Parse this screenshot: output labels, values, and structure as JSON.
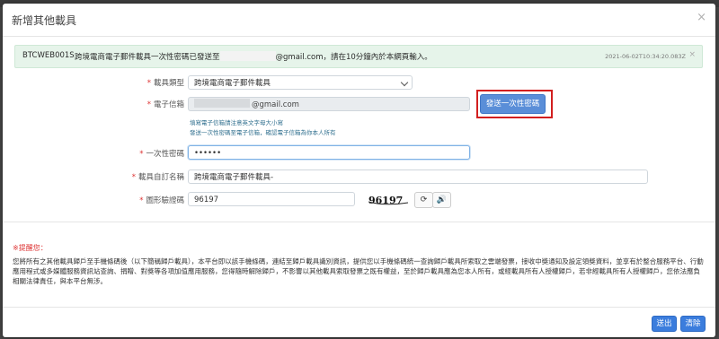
{
  "modal": {
    "title": "新增其他載具",
    "close_icon": "×"
  },
  "alert": {
    "code": "BTCWEB001S",
    "message_prefix": "跨境電商電子郵件載具一次性密碼已發送至",
    "message_suffix": "@gmail.com，請在10分鐘內於本網頁輸入。",
    "timestamp": "2021-06-02T10:34:20.083Z",
    "close_icon": "×"
  },
  "form": {
    "carrier_type": {
      "label": "載具類型",
      "value": "跨境電商電子郵件載具"
    },
    "email": {
      "label": "電子信箱",
      "value": "@gmail.com"
    },
    "send_otp_label": "發送一次性密碼",
    "hints": [
      "填寫電子信箱請注意英文字母大小寫",
      "發送一次性密碼至電子信箱，確認電子信箱為你本人所有"
    ],
    "otp": {
      "label": "一次性密碼",
      "value": "••••••"
    },
    "nickname": {
      "label": "載具自訂名稱",
      "value": "跨境電商電子郵件載具-"
    },
    "captcha": {
      "label": "圖形驗證碼",
      "value": "96197",
      "image_text": "96197",
      "refresh_icon": "⟳",
      "audio_icon": "🔊"
    }
  },
  "notice": {
    "title": "※提醒您：",
    "body": "您將所有之其他載具歸戶至手機條碼後（以下簡稱歸戶載具），本平台即以該手機條碼，連結至歸戶載具識別資訊，提供您以手機條碼統一查詢歸戶載具所索取之雲端發票，接收中獎通知及設定領獎資料，並享有於整合服務平台、行動應用程式或多媒體服務資訊站查詢、捐贈、對獎等各項加值應用服務，您得隨時解除歸戶，不影響以其他載具索取發票之既有權益，至於歸戶載具應為您本人所有，或經載具所有人授權歸戶，若非經載具所有人授權歸戶，您依法應負相關法律責任，與本平台無涉。"
  },
  "footer": {
    "submit_label": "送出",
    "clear_label": "清除"
  }
}
